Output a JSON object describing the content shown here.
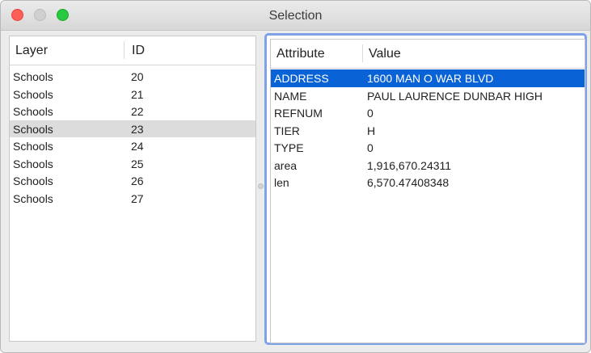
{
  "window": {
    "title": "Selection"
  },
  "left_table": {
    "columns": [
      "Layer",
      "ID"
    ],
    "rows": [
      {
        "layer": "Schools",
        "id": "20"
      },
      {
        "layer": "Schools",
        "id": "21"
      },
      {
        "layer": "Schools",
        "id": "22"
      },
      {
        "layer": "Schools",
        "id": "23"
      },
      {
        "layer": "Schools",
        "id": "24"
      },
      {
        "layer": "Schools",
        "id": "25"
      },
      {
        "layer": "Schools",
        "id": "26"
      },
      {
        "layer": "Schools",
        "id": "27"
      }
    ],
    "highlighted_row_index": 3
  },
  "right_table": {
    "columns": [
      "Attribute",
      "Value"
    ],
    "rows": [
      {
        "attribute": "ADDRESS",
        "value": "1600 MAN O WAR BLVD"
      },
      {
        "attribute": "NAME",
        "value": "PAUL LAURENCE DUNBAR HIGH"
      },
      {
        "attribute": "REFNUM",
        "value": "0"
      },
      {
        "attribute": "TIER",
        "value": "H"
      },
      {
        "attribute": "TYPE",
        "value": "0"
      },
      {
        "attribute": "area",
        "value": "1,916,670.24311"
      },
      {
        "attribute": "len",
        "value": "6,570.47408348"
      }
    ],
    "selected_row_index": 0
  },
  "colors": {
    "selection": "#0a63d6",
    "focus_ring": "#7da2e8",
    "highlight_row": "#dcdcdc"
  }
}
